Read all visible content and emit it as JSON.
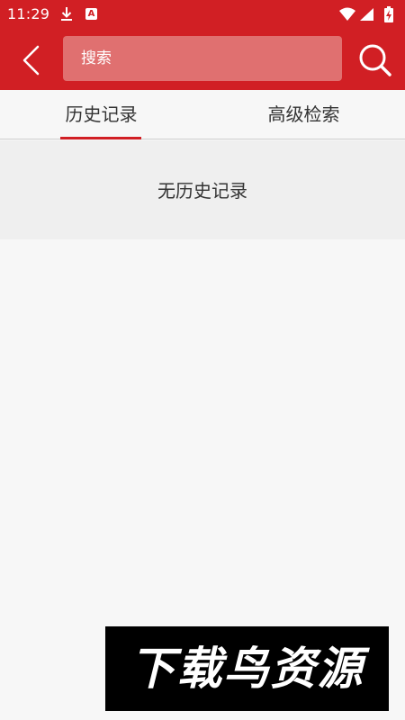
{
  "status_bar": {
    "time": "11:29",
    "icons": [
      "download-icon",
      "a-notification-icon",
      "wifi-icon",
      "signal-icon",
      "battery-charging-icon"
    ],
    "a_label": "A"
  },
  "header": {
    "back_icon": "chevron-left-icon",
    "search_placeholder": "搜索",
    "search_icon": "search-icon",
    "background": "#d11f24"
  },
  "tabs": [
    {
      "label": "历史记录",
      "active": true
    },
    {
      "label": "高级检索",
      "active": false
    }
  ],
  "empty_state": {
    "text": "无历史记录"
  },
  "watermark": {
    "text": "下载鸟资源"
  },
  "colors": {
    "accent": "#d11f24",
    "page_background": "#f7f7f7"
  }
}
